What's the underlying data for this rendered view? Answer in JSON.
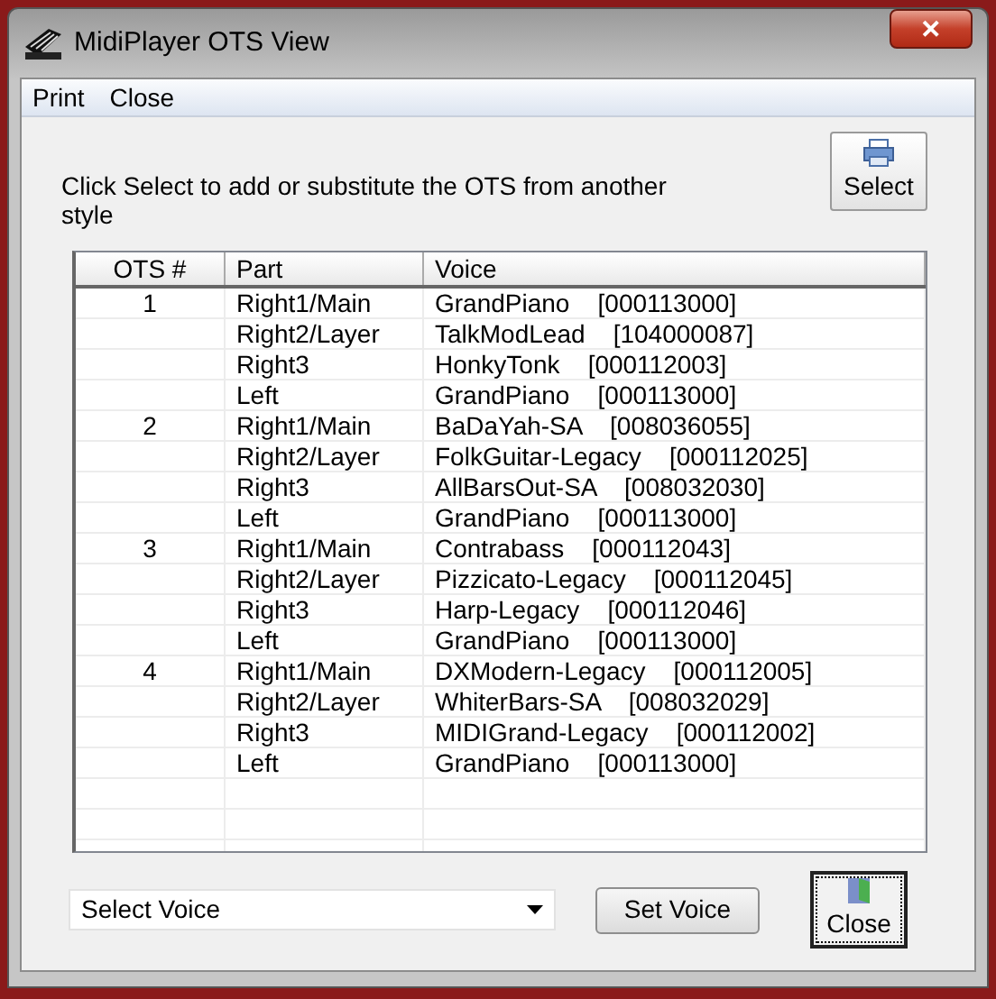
{
  "window": {
    "title": "MidiPlayer OTS View",
    "close_glyph": "✕"
  },
  "menu": [
    "Print",
    "Close"
  ],
  "instruction": "Click Select to add or substitute the OTS from another style",
  "select_button": {
    "label": "Select"
  },
  "table": {
    "columns": [
      "OTS #",
      "Part",
      "Voice"
    ],
    "rows": [
      {
        "ots": "1",
        "part": "Right1/Main",
        "voice": "GrandPiano    [000113000]"
      },
      {
        "part": "Right2/Layer",
        "voice": "TalkModLead    [104000087]"
      },
      {
        "part": "Right3",
        "voice": "HonkyTonk    [000112003]"
      },
      {
        "part": "Left",
        "voice": "GrandPiano    [000113000]"
      },
      {
        "ots": "2",
        "part": "Right1/Main",
        "voice": "BaDaYah-SA    [008036055]"
      },
      {
        "part": "Right2/Layer",
        "voice": "FolkGuitar-Legacy    [000112025]"
      },
      {
        "part": "Right3",
        "voice": "AllBarsOut-SA    [008032030]"
      },
      {
        "part": "Left",
        "voice": "GrandPiano    [000113000]"
      },
      {
        "ots": "3",
        "part": "Right1/Main",
        "voice": "Contrabass    [000112043]"
      },
      {
        "part": "Right2/Layer",
        "voice": "Pizzicato-Legacy    [000112045]"
      },
      {
        "part": "Right3",
        "voice": "Harp-Legacy    [000112046]"
      },
      {
        "part": "Left",
        "voice": "GrandPiano    [000113000]"
      },
      {
        "ots": "4",
        "part": "Right1/Main",
        "voice": "DXModern-Legacy    [000112005]"
      },
      {
        "part": "Right2/Layer",
        "voice": "WhiterBars-SA    [008032029]"
      },
      {
        "part": "Right3",
        "voice": "MIDIGrand-Legacy    [000112002]"
      },
      {
        "part": "Left",
        "voice": "GrandPiano    [000113000]"
      }
    ]
  },
  "voice_dropdown": {
    "value": "Select Voice"
  },
  "set_voice_button": {
    "label": "Set Voice"
  },
  "close_button": {
    "label": "Close"
  }
}
